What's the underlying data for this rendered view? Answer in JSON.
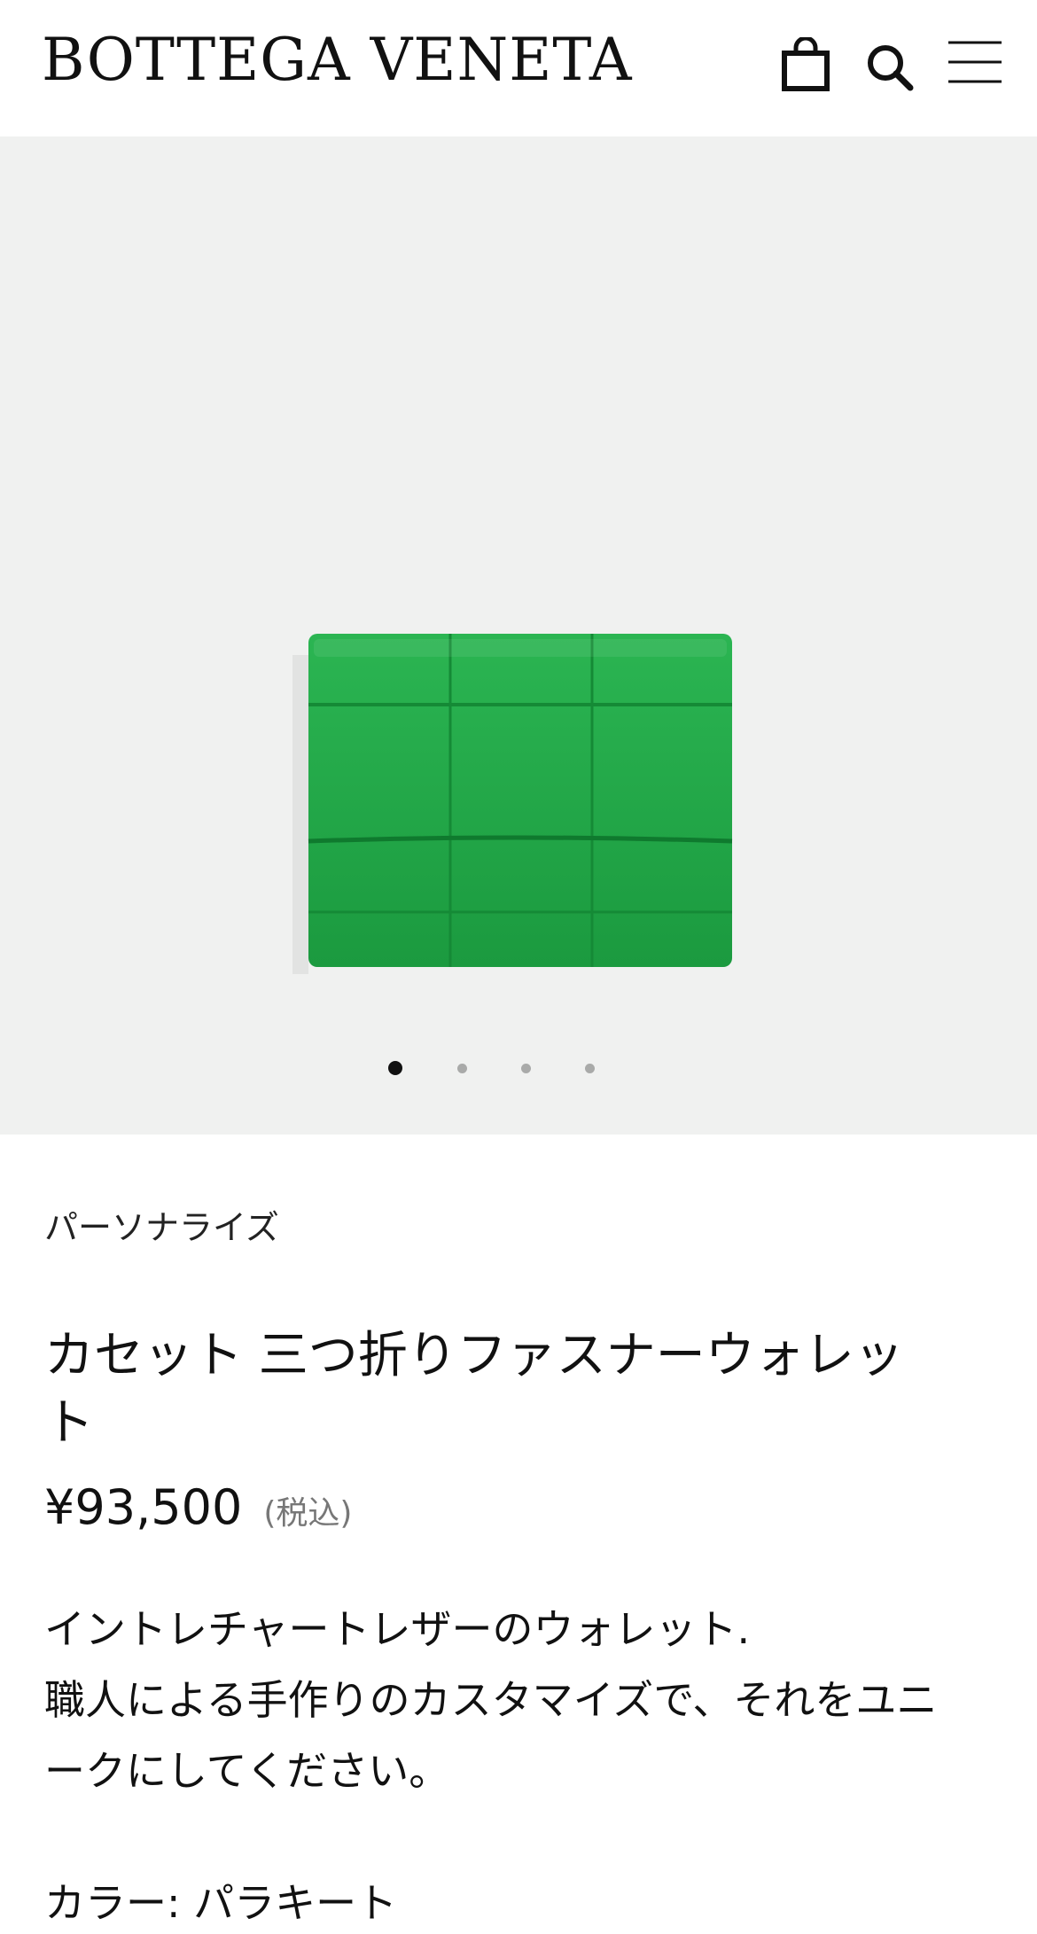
{
  "header": {
    "brand": "BOTTEGA VENETA",
    "icons": [
      "shopping-bag-icon",
      "search-icon",
      "menu-icon"
    ]
  },
  "gallery": {
    "image_count": 4,
    "active_index": 0,
    "product_color": "#1fa346"
  },
  "product": {
    "personalize_label": "パーソナライズ",
    "title_line1": "カセット 三つ折りファスナーウォレッ",
    "title_line2": "ト",
    "price": "¥93,500",
    "tax_note": "(税込)",
    "description_lines": [
      "イントレチャートレザーのウォレット.",
      "職人による手作りのカスタマイズで、それをユニ",
      "ークにしてください。"
    ],
    "color_label": "カラー: パラキート"
  }
}
